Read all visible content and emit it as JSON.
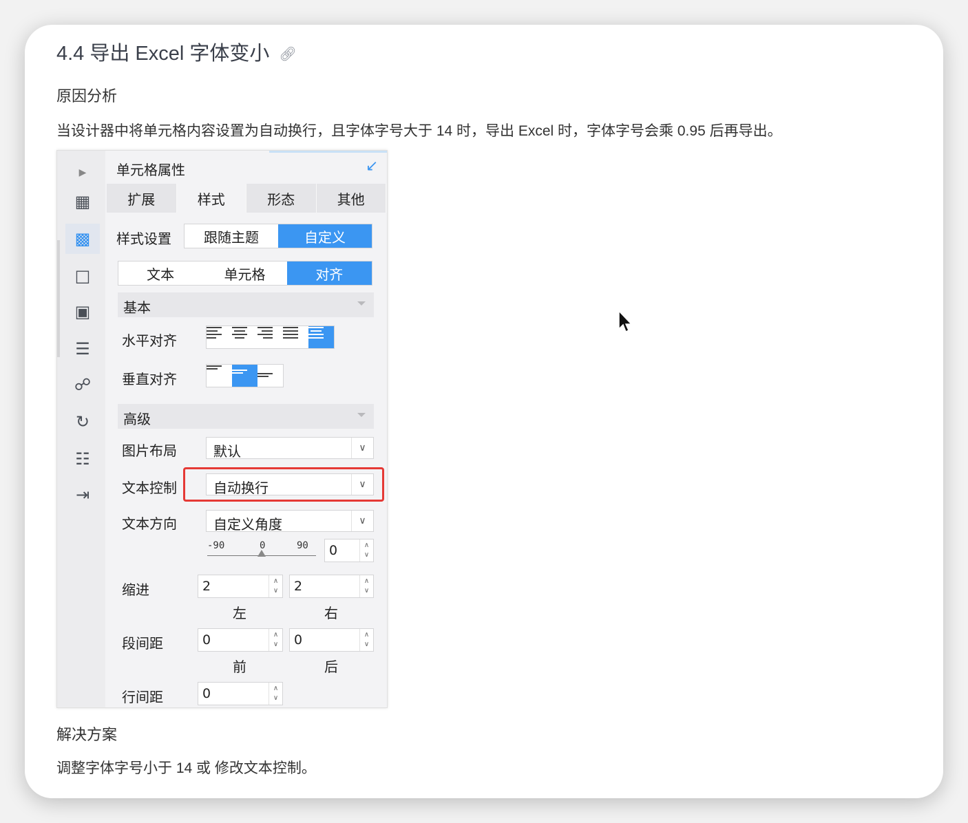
{
  "article": {
    "heading": "4.4 导出 Excel 字体变小",
    "link_icon": "link-icon",
    "cause_heading": "原因分析",
    "cause_text": "当设计器中将单元格内容设置为自动换行，且字体字号大于 14 时，导出 Excel 时，字体字号会乘 0.95 后再导出。",
    "solution_heading": "解决方案",
    "solution_text": "调整字体字号小于 14 或 修改文本控制。"
  },
  "panel": {
    "title": "单元格属性",
    "tabs": [
      "扩展",
      "样式",
      "形态",
      "其他"
    ],
    "style_setting_label": "样式设置",
    "style_options": [
      "跟随主题",
      "自定义"
    ],
    "sub_tabs": [
      "文本",
      "单元格",
      "对齐"
    ],
    "basic_section": "基本",
    "halign_label": "水平对齐",
    "valign_label": "垂直对齐",
    "advanced_section": "高级",
    "image_layout_label": "图片布局",
    "image_layout_value": "默认",
    "text_control_label": "文本控制",
    "text_control_value": "自动换行",
    "text_direction_label": "文本方向",
    "text_direction_value": "自定义角度",
    "angle_ticks": [
      "-90",
      "0",
      "90"
    ],
    "angle_value": "0",
    "indent_label": "缩进",
    "indent_left": "2",
    "indent_right": "2",
    "left_label": "左",
    "right_label": "右",
    "para_spacing_label": "段间距",
    "para_before": "0",
    "para_after": "0",
    "before_label": "前",
    "after_label": "后",
    "line_spacing_label": "行间距",
    "line_spacing_value": "0"
  },
  "colors": {
    "accent": "#3b96f2",
    "highlight": "#e53935"
  }
}
